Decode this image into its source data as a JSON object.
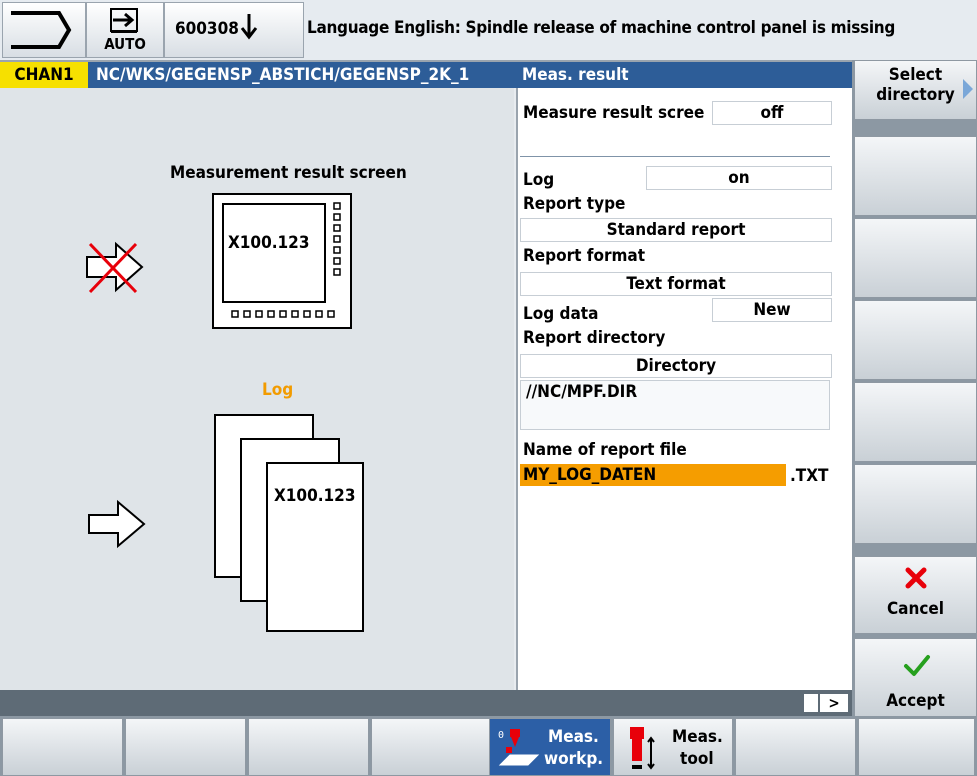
{
  "header": {
    "mode": "AUTO",
    "program_number": "600308",
    "alarm_text": "Language English: Spindle release of machine control panel is missing"
  },
  "pathbar": {
    "channel": "CHAN1",
    "path": "NC/WKS/GEGENSP_ABSTICH/GEGENSP_2K_1",
    "title": "Meas. result"
  },
  "left_panel": {
    "screen_title": "Measurement result screen",
    "screen_value": "X100.123",
    "log_title": "Log",
    "log_value": "X100.123"
  },
  "form": {
    "measure_result_screen_label": "Measure result scree",
    "measure_result_screen_value": "off",
    "log_label": "Log",
    "log_value": "on",
    "report_type_label": "Report type",
    "report_type_value": "Standard report",
    "report_format_label": "Report format",
    "report_format_value": "Text format",
    "log_data_label": "Log data",
    "log_data_value": "New",
    "report_directory_label": "Report directory",
    "report_directory_value": "Directory",
    "directory_path": "//NC/MPF.DIR",
    "report_file_label": "Name of report file",
    "report_file_value": "MY_LOG_DATEN",
    "report_file_ext": ".TXT"
  },
  "vertical_softkeys": {
    "select_directory_line1": "Select",
    "select_directory_line2": "directory",
    "cancel": "Cancel",
    "accept": "Accept"
  },
  "horizontal_softkeys": {
    "meas_workp_line1": "Meas.",
    "meas_workp_line2": "workp.",
    "meas_tool_line1": "Meas.",
    "meas_tool_line2": "tool"
  },
  "status": {
    "scroll_arrow": ">"
  },
  "colors": {
    "path_blue": "#2d5d98",
    "channel_yellow": "#f6e000",
    "log_orange": "#f29b00",
    "input_highlight": "#f59d00",
    "cancel_red": "#e8000a",
    "accept_green": "#26a01e"
  }
}
